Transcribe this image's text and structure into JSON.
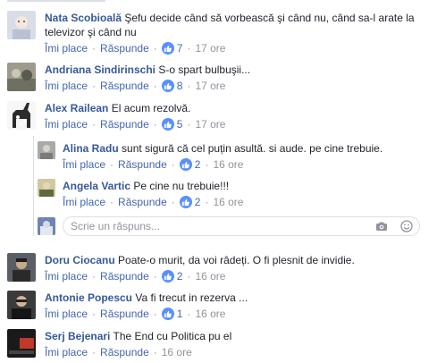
{
  "colors": {
    "name": "#365899",
    "link": "#4267b2",
    "like": "#5890ff",
    "meta": "#90949c"
  },
  "labels": {
    "like": "Îmi place",
    "reply": "Răspunde",
    "separator": "·"
  },
  "comments": [
    {
      "name": "Nata Scobioală",
      "text": "Şefu decide când să vorbească şi când nu, când sa-l arate la",
      "text2": "televizor şi când nu",
      "likes": "7",
      "time": "17 ore"
    },
    {
      "name": "Andriana Sindirinschi",
      "text": "S-o spart bulbuşii...",
      "likes": "8",
      "time": "17 ore"
    },
    {
      "name": "Alex Railean",
      "text": "El acum rezolvă.",
      "likes": "5",
      "time": "17 ore"
    },
    {
      "name": "Doru Ciocanu",
      "text": "Poate-o murit, da voi râdeți. O fi plesnit de invidie.",
      "likes": "2",
      "time": "16 ore"
    },
    {
      "name": "Antonie Popescu",
      "text": "Va fi trecut in rezerva ...",
      "likes": "1",
      "time": "16 ore"
    },
    {
      "name": "Serj Bejenari",
      "text": "The End cu Politica pu el",
      "time": "16 ore"
    }
  ],
  "replies": [
    {
      "name": "Alina Radu",
      "text": "sunt sigură că cel puțin asultă. si aude. pe cine trebuie.",
      "likes": "2",
      "time": "16 ore"
    },
    {
      "name": "Angela Vartic",
      "text": "Pe cine nu trebuie!!!",
      "likes": "2",
      "time": "16 ore"
    }
  ],
  "reply_box": {
    "placeholder": "Scrie un răspuns...",
    "icons": [
      "camera-icon",
      "emoji-icon"
    ]
  }
}
